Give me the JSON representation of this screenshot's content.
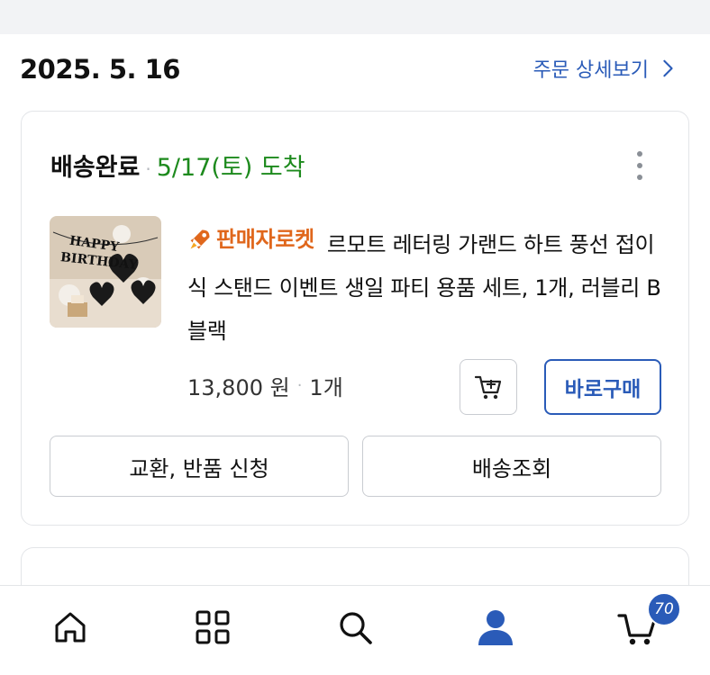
{
  "order": {
    "date": "2025. 5. 16",
    "detail_link_label": "주문 상세보기"
  },
  "shipment": {
    "status": "배송완료",
    "eta": "5/17(토) 도착"
  },
  "product": {
    "badge": "판매자로켓",
    "title": "르모트 레터링 가랜드 하트 풍선 접이식 스탠드 이벤트 생일 파티 용품 세트, 1개, 러블리 B 블랙",
    "price": "13,800 원",
    "quantity": "1개",
    "thumb_text_1": "HAPPY",
    "thumb_text_2": "BIRTHDAY"
  },
  "buttons": {
    "buy_now": "바로구매",
    "return": "교환, 반품 신청",
    "track": "배송조회"
  },
  "nav": {
    "cart_count": "70",
    "items": [
      "home-icon",
      "category-icon",
      "search-icon",
      "my-page-icon",
      "cart-icon"
    ]
  },
  "colors": {
    "accent": "#2a5bb8",
    "delivered_green": "#1d8a1d",
    "rocket_orange": "#e0671c"
  }
}
